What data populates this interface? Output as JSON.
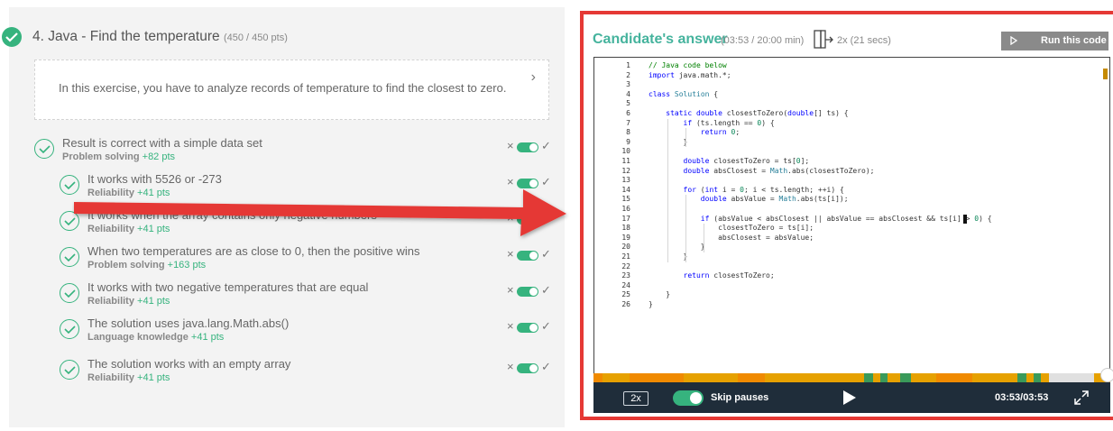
{
  "question": {
    "title": "4. Java - Find the temperature",
    "points": "(450 / 450 pts)",
    "description": "In this exercise, you have to analyze records of temperature to find the closest to zero."
  },
  "tests": [
    {
      "title": "Result is correct with a simple data set",
      "category": "Problem solving",
      "points": "+82 pts"
    },
    {
      "title": "It works with 5526 or -273",
      "category": "Reliability",
      "points": "+41 pts"
    },
    {
      "title": "It works when the array contains only negative numbers",
      "category": "Reliability",
      "points": "+41 pts"
    },
    {
      "title": "When two temperatures are as close to 0, then the positive wins",
      "category": "Problem solving",
      "points": "+163 pts"
    },
    {
      "title": "It works with two negative temperatures that are equal",
      "category": "Reliability",
      "points": "+41 pts"
    },
    {
      "title": "The solution uses java.lang.Math.abs()",
      "category": "Language knowledge",
      "points": "+41 pts"
    },
    {
      "title": "The solution works with an empty array",
      "category": "Reliability",
      "points": "+41 pts"
    }
  ],
  "toggle_icons": {
    "reject": "×",
    "accept": "✓"
  },
  "answer": {
    "title": "Candidate's answer",
    "time": "(03:53 / 20:00 min)",
    "speed": "2x (21 secs)",
    "run_button": "Run this code"
  },
  "code": {
    "line_numbers": [
      "1",
      "2",
      "3",
      "4",
      "5",
      "6",
      "7",
      "8",
      "9",
      "10",
      "11",
      "12",
      "13",
      "14",
      "15",
      "16",
      "17",
      "18",
      "19",
      "20",
      "21",
      "22",
      "23",
      "24",
      "25",
      "26"
    ],
    "lines": [
      "// Java code below",
      "import java.math.*;",
      "",
      "class Solution {",
      "",
      "    static double closestToZero(double[] ts) {",
      "        if (ts.length == 0) {",
      "            return 0;",
      "        }",
      "",
      "        double closestToZero = ts[0];",
      "        double absClosest = Math.abs(closestToZero);",
      "",
      "        for (int i = 0; i < ts.length; ++i) {",
      "            double absValue = Math.abs(ts[i]);",
      "",
      "            if (absValue < absClosest || absValue == absClosest && ts[i] > 0) {",
      "                closestToZero = ts[i];",
      "                absClosest = absValue;",
      "            }",
      "        }",
      "",
      "        return closestToZero;",
      "",
      "    }",
      "}"
    ]
  },
  "player": {
    "speed_button": "2x",
    "skip_pauses_label": "Skip pauses",
    "skip_pauses_on": true,
    "time": "03:53/03:53",
    "progress": 1.0
  },
  "colors": {
    "accent_green": "#36b37e",
    "title_teal": "#45b39d",
    "highlight_red": "#e53935",
    "player_bg": "#1f2d3a",
    "timeline_orange": "#e6a100"
  }
}
